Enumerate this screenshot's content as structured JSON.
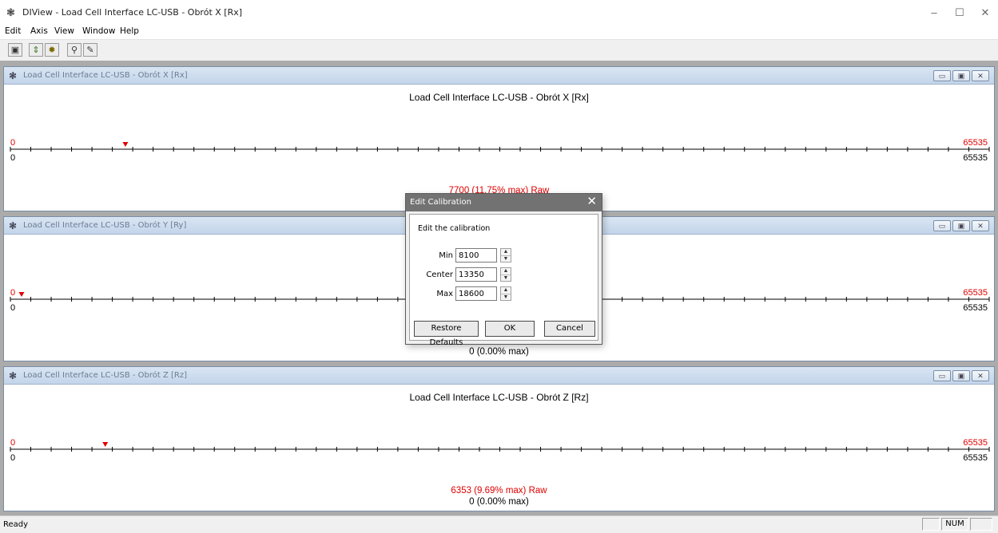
{
  "app": {
    "title": "DIView - Load Cell Interface LC-USB - Obrót X [Rx]",
    "icon": "app-logo-icon",
    "controls": {
      "minimize": "–",
      "maximize": "☐",
      "close": "✕"
    }
  },
  "menu": {
    "items": [
      "Edit",
      "Axis",
      "View",
      "Window",
      "Help"
    ]
  },
  "toolbar": {
    "buttons": [
      "save-icon",
      "refresh-arrows-icon",
      "gear-icon",
      "key-icon",
      "edit-icon"
    ]
  },
  "panels": [
    {
      "title": "Load Cell Interface LC-USB - Obrót X [Rx]",
      "plot_title": "Load Cell Interface LC-USB - Obrót X [Rx]",
      "min_red": "0",
      "max_red": "65535",
      "min_black": "0",
      "max_black": "65535",
      "marker_fraction": 0.1175,
      "raw_text": "7700 (11.75% max)  Raw",
      "value_text": ""
    },
    {
      "title": "Load Cell Interface LC-USB - Obrót Y [Ry]",
      "plot_title": "",
      "min_red": "0",
      "max_red": "65535",
      "min_black": "0",
      "max_black": "65535",
      "marker_fraction": 0.0,
      "raw_text": "",
      "value_text": "0 (0.00% max)"
    },
    {
      "title": "Load Cell Interface LC-USB - Obrót Z [Rz]",
      "plot_title": "Load Cell Interface LC-USB - Obrót Z [Rz]",
      "min_red": "0",
      "max_red": "65535",
      "min_black": "0",
      "max_black": "65535",
      "marker_fraction": 0.0969,
      "raw_text": "6353 (9.69% max)  Raw",
      "value_text": "0 (0.00% max)"
    }
  ],
  "dialog": {
    "title": "Edit Calibration",
    "description": "Edit the calibration",
    "fields": [
      {
        "label": "Min",
        "value": "8100"
      },
      {
        "label": "Center",
        "value": "13350"
      },
      {
        "label": "Max",
        "value": "18600"
      }
    ],
    "buttons": {
      "restore": "Restore Defaults",
      "ok": "OK",
      "cancel": "Cancel"
    }
  },
  "status": {
    "text": "Ready",
    "num": "NUM"
  },
  "colors": {
    "accent_red": "#e00000",
    "dialog_title": "#727272",
    "mdi_background": "#ababab"
  }
}
